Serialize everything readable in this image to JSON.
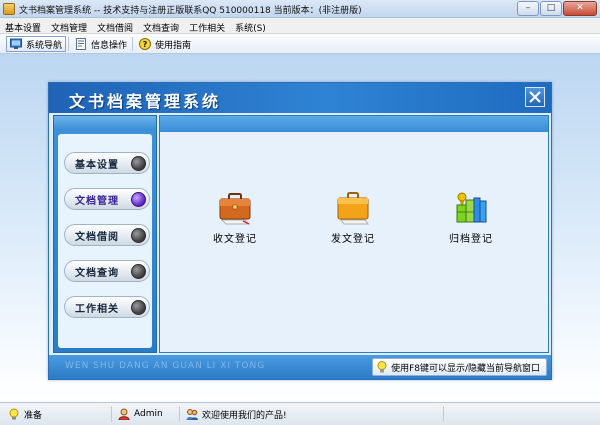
{
  "window": {
    "title": "文书档案管理系统 -- 技术支持与注册正版联系QQ 510000118   当前版本：(非注册版)",
    "buttons": {
      "minimize": "–",
      "maximize": "□",
      "close": "✕"
    }
  },
  "menubar": {
    "items": [
      {
        "label": "基本设置"
      },
      {
        "label": "文档管理"
      },
      {
        "label": "文档借阅"
      },
      {
        "label": "文档查询"
      },
      {
        "label": "工作相关"
      },
      {
        "label": "系统(S)"
      }
    ]
  },
  "toolbar": {
    "items": [
      {
        "label": "系统导航",
        "icon": "monitor-icon",
        "active": true
      },
      {
        "label": "信息操作",
        "icon": "document-icon",
        "active": false
      },
      {
        "label": "使用指南",
        "icon": "help-icon",
        "active": false
      }
    ]
  },
  "panel": {
    "title": "文书档案管理系统",
    "watermark": "WEN SHU DANG AN GUAN LI XI TONG",
    "tip": "使用F8键可以显示/隐藏当前导航窗口"
  },
  "nav": {
    "buttons": [
      {
        "label": "基本设置",
        "active": false
      },
      {
        "label": "文档管理",
        "active": true
      },
      {
        "label": "文档借阅",
        "active": false
      },
      {
        "label": "文档查询",
        "active": false
      },
      {
        "label": "工作相关",
        "active": false
      }
    ]
  },
  "functions": [
    {
      "label": "收文登记",
      "icon": "briefcase-icon"
    },
    {
      "label": "发文登记",
      "icon": "folder-icon"
    },
    {
      "label": "归档登记",
      "icon": "archive-books-icon"
    }
  ],
  "status": {
    "ready": "准备",
    "user": "Admin",
    "welcome": "欢迎使用我们的产品!"
  },
  "colors": {
    "header_blue": "#2f83d4",
    "active_nav": "#5a20c0"
  }
}
